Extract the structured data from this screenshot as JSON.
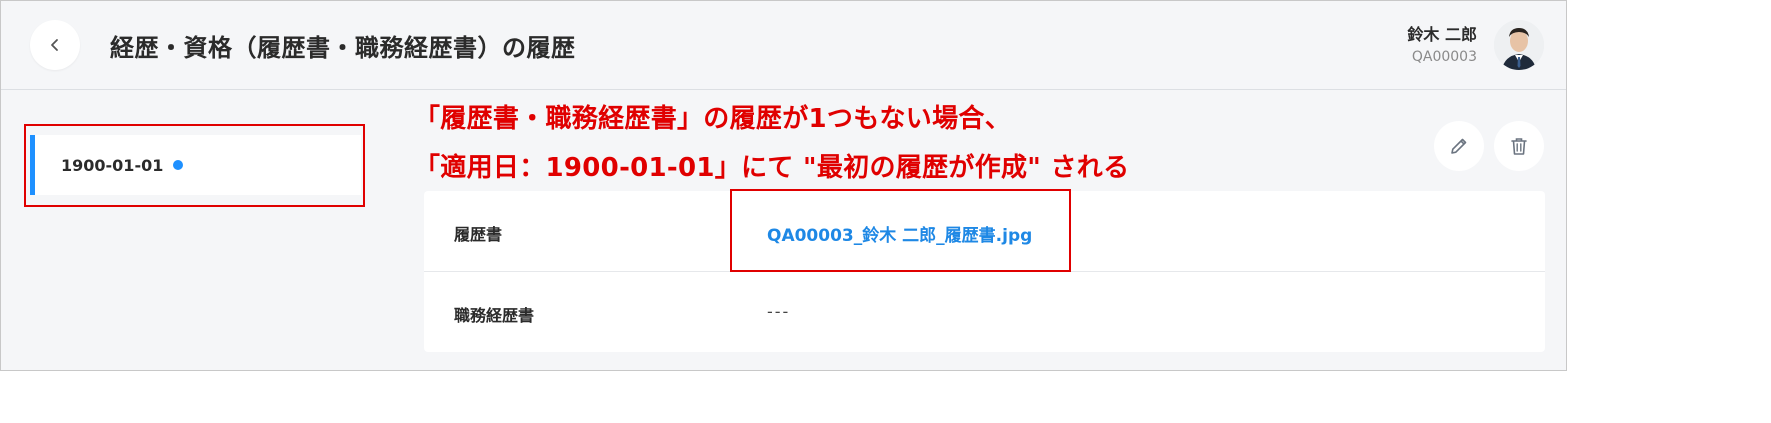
{
  "header": {
    "title": "経歴・資格（履歴書・職務経歴書）の履歴",
    "user_name": "鈴木 二郎",
    "user_id": "QA00003"
  },
  "history": {
    "items": [
      {
        "date": "1900-01-01",
        "active": true
      }
    ]
  },
  "annotation": {
    "line1": "「履歴書・職務経歴書」の履歴が1つもない場合、",
    "line2": "「適用日：1900-01-01」にて \"最初の履歴が作成\" される"
  },
  "detail": {
    "rows": [
      {
        "label": "履歴書",
        "value": "QA00003_鈴木 二郎_履歴書.jpg",
        "is_link": true
      },
      {
        "label": "職務経歴書",
        "value": "---",
        "is_link": false
      }
    ]
  },
  "icons": {
    "back": "chevron-left-icon",
    "edit": "pencil-icon",
    "delete": "trash-icon"
  },
  "colors": {
    "accent": "#1e90ff",
    "link": "#1e88e5",
    "annotation": "#e00000",
    "background": "#f5f6f8"
  }
}
